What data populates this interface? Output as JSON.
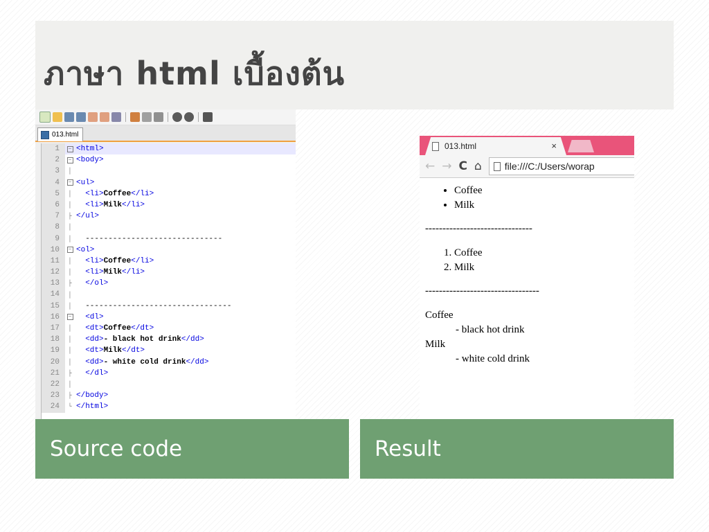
{
  "slide": {
    "title": "ภาษา html เบื้องต้น"
  },
  "editor": {
    "tab_label": "013.html",
    "lines": [
      {
        "n": "1",
        "fold": "box",
        "parts": [
          [
            "tag",
            "<html>"
          ]
        ]
      },
      {
        "n": "2",
        "fold": "box",
        "parts": [
          [
            "tag",
            "<body>"
          ]
        ]
      },
      {
        "n": "3",
        "fold": "line",
        "parts": []
      },
      {
        "n": "4",
        "fold": "box",
        "parts": [
          [
            "tag",
            "<ul>"
          ]
        ]
      },
      {
        "n": "5",
        "fold": "line",
        "parts": [
          [
            "plain",
            "  "
          ],
          [
            "tag",
            "<li>"
          ],
          [
            "txt",
            "Coffee"
          ],
          [
            "tag",
            "</li>"
          ]
        ]
      },
      {
        "n": "6",
        "fold": "line",
        "parts": [
          [
            "plain",
            "  "
          ],
          [
            "tag",
            "<li>"
          ],
          [
            "txt",
            "Milk"
          ],
          [
            "tag",
            "</li>"
          ]
        ]
      },
      {
        "n": "7",
        "fold": "end",
        "parts": [
          [
            "tag",
            "</ul>"
          ]
        ]
      },
      {
        "n": "8",
        "fold": "line",
        "parts": []
      },
      {
        "n": "9",
        "fold": "line",
        "parts": [
          [
            "plain",
            "  ------------------------------"
          ]
        ]
      },
      {
        "n": "10",
        "fold": "box",
        "parts": [
          [
            "tag",
            "<ol>"
          ]
        ]
      },
      {
        "n": "11",
        "fold": "line",
        "parts": [
          [
            "plain",
            "  "
          ],
          [
            "tag",
            "<li>"
          ],
          [
            "txt",
            "Coffee"
          ],
          [
            "tag",
            "</li>"
          ]
        ]
      },
      {
        "n": "12",
        "fold": "line",
        "parts": [
          [
            "plain",
            "  "
          ],
          [
            "tag",
            "<li>"
          ],
          [
            "txt",
            "Milk"
          ],
          [
            "tag",
            "</li>"
          ]
        ]
      },
      {
        "n": "13",
        "fold": "end",
        "parts": [
          [
            "plain",
            "  "
          ],
          [
            "tag",
            "</ol>"
          ]
        ]
      },
      {
        "n": "14",
        "fold": "line",
        "parts": []
      },
      {
        "n": "15",
        "fold": "line",
        "parts": [
          [
            "plain",
            "  --------------------------------"
          ]
        ]
      },
      {
        "n": "16",
        "fold": "box",
        "parts": [
          [
            "plain",
            "  "
          ],
          [
            "tag",
            "<dl>"
          ]
        ]
      },
      {
        "n": "17",
        "fold": "line",
        "parts": [
          [
            "plain",
            "  "
          ],
          [
            "tag",
            "<dt>"
          ],
          [
            "txt",
            "Coffee"
          ],
          [
            "tag",
            "</dt>"
          ]
        ]
      },
      {
        "n": "18",
        "fold": "line",
        "parts": [
          [
            "plain",
            "  "
          ],
          [
            "tag",
            "<dd>"
          ],
          [
            "txt",
            "- black hot drink"
          ],
          [
            "tag",
            "</dd>"
          ]
        ]
      },
      {
        "n": "19",
        "fold": "line",
        "parts": [
          [
            "plain",
            "  "
          ],
          [
            "tag",
            "<dt>"
          ],
          [
            "txt",
            "Milk"
          ],
          [
            "tag",
            "</dt>"
          ]
        ]
      },
      {
        "n": "20",
        "fold": "line",
        "parts": [
          [
            "plain",
            "  "
          ],
          [
            "tag",
            "<dd>"
          ],
          [
            "txt",
            "- white cold drink"
          ],
          [
            "tag",
            "</dd>"
          ]
        ]
      },
      {
        "n": "21",
        "fold": "end",
        "parts": [
          [
            "plain",
            "  "
          ],
          [
            "tag",
            "</dl>"
          ]
        ]
      },
      {
        "n": "22",
        "fold": "line",
        "parts": []
      },
      {
        "n": "23",
        "fold": "end",
        "parts": [
          [
            "tag",
            "</body>"
          ]
        ]
      },
      {
        "n": "24",
        "fold": "last",
        "parts": [
          [
            "tag",
            "</html>"
          ]
        ]
      }
    ],
    "colors": {
      "tag": "#0000e0",
      "text": "#000000",
      "current_line": "#e8e8ff"
    }
  },
  "browser": {
    "tab_title": "013.html",
    "tab_close": "×",
    "address": "file:///C:/Users/worap",
    "ul_items": [
      "Coffee",
      "Milk"
    ],
    "separator1": "-------------------------------",
    "ol_items": [
      "Coffee",
      "Milk"
    ],
    "separator2": "---------------------------------",
    "dl": [
      {
        "dt": "Coffee",
        "dd": "- black hot drink"
      },
      {
        "dt": "Milk",
        "dd": "- white cold drink"
      }
    ],
    "colors": {
      "tab_strip": "#e9547a"
    }
  },
  "captions": {
    "left": "Source code",
    "right": "Result"
  },
  "colors": {
    "caption_bg": "#6fa072",
    "title_band": "#f0f0ee"
  }
}
